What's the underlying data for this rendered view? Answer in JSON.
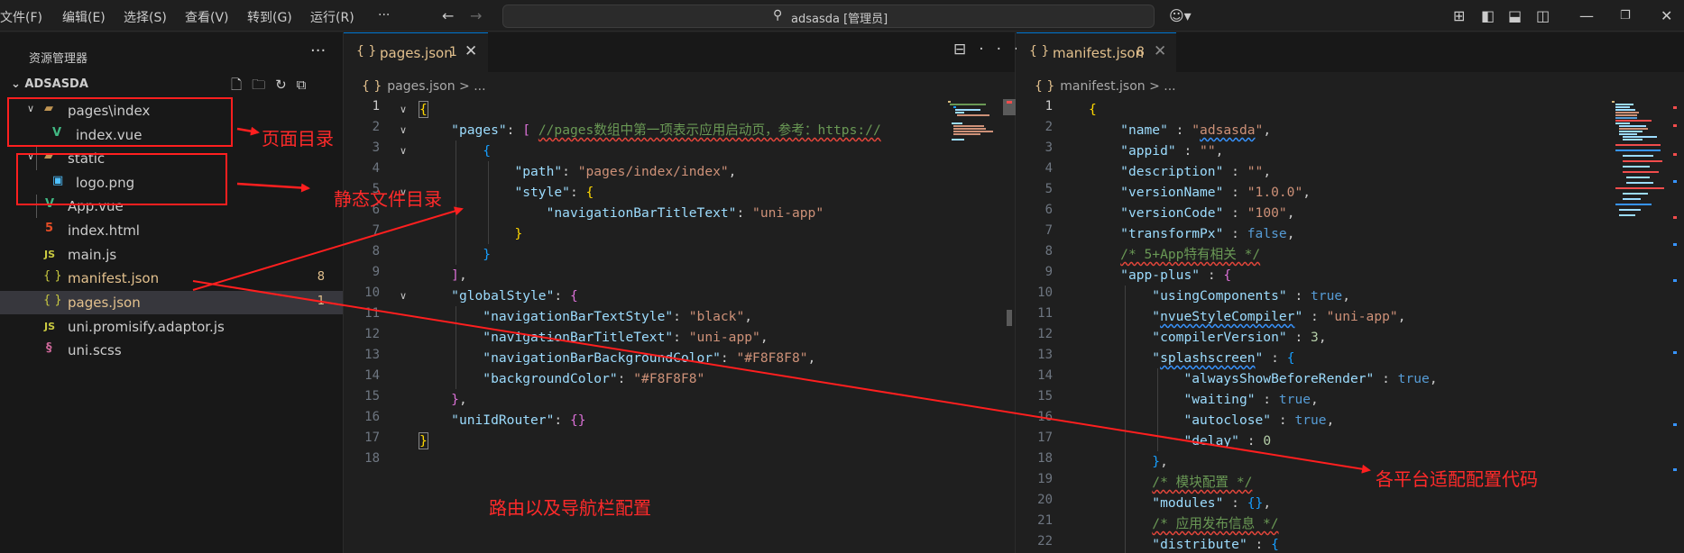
{
  "titlebar": {
    "menus": [
      "文件(F)",
      "编辑(E)",
      "选择(S)",
      "查看(V)",
      "转到(G)",
      "运行(R)"
    ],
    "more": "···",
    "search_text": "adsasda [管理员]",
    "icons": [
      "back-arrow-icon",
      "forward-arrow-icon",
      "search-icon",
      "copilot-icon",
      "layout-icon",
      "sidebar-toggle-icon",
      "panel-toggle-icon",
      "secondary-sidebar-icon",
      "minimize-icon",
      "restore-icon",
      "close-icon"
    ]
  },
  "sidebar": {
    "title": "资源管理器",
    "more": "···",
    "project": "ADSASDA",
    "tree": [
      {
        "label": "pages\\index",
        "type": "folder",
        "expanded": true,
        "depth": 1
      },
      {
        "label": "index.vue",
        "type": "vue",
        "depth": 2
      },
      {
        "label": "static",
        "type": "folder",
        "expanded": true,
        "depth": 1
      },
      {
        "label": "logo.png",
        "type": "image",
        "depth": 2
      },
      {
        "label": "App.vue",
        "type": "vue",
        "depth": 1
      },
      {
        "label": "index.html",
        "type": "html",
        "depth": 1
      },
      {
        "label": "main.js",
        "type": "js",
        "depth": 1
      },
      {
        "label": "manifest.json",
        "type": "json",
        "depth": 1,
        "badge": "8",
        "warning": true
      },
      {
        "label": "pages.json",
        "type": "json",
        "depth": 1,
        "badge": "1",
        "warning": true,
        "selected": true
      },
      {
        "label": "uni.promisify.adaptor.js",
        "type": "js",
        "depth": 1
      },
      {
        "label": "uni.scss",
        "type": "scss",
        "depth": 1
      }
    ]
  },
  "editor_left": {
    "tab_icon": "{ }",
    "tab_name": "pages.json",
    "tab_count": "1",
    "breadcrumb": "pages.json > ...",
    "line_numbers": [
      "1",
      "2",
      "3",
      "4",
      "5",
      "6",
      "7",
      "8",
      "9",
      "10",
      "11",
      "12",
      "13",
      "14",
      "15",
      "16",
      "17",
      "18"
    ]
  },
  "editor_right": {
    "tab_icon": "{ }",
    "tab_name": "manifest.json",
    "tab_count": "8",
    "breadcrumb": "manifest.json > ...",
    "line_numbers": [
      "1",
      "2",
      "3",
      "4",
      "5",
      "6",
      "7",
      "8",
      "9",
      "10",
      "11",
      "12",
      "13",
      "14",
      "15",
      "16",
      "17",
      "18",
      "19",
      "20",
      "21",
      "22"
    ]
  },
  "annotations": {
    "page_dir": "页面目录",
    "static_dir": "静态文件目录",
    "router_nav": "路由以及导航栏配置",
    "platform_config": "各平台适配配置代码"
  },
  "colors": {
    "annotation": "#ff1f1f",
    "warning": "#e2c08d",
    "accent": "#0078d4"
  }
}
